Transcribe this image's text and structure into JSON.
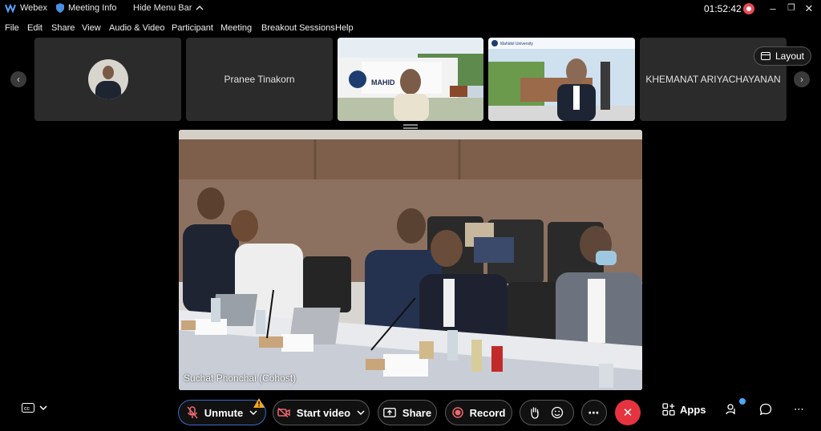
{
  "titlebar": {
    "app_name": "Webex",
    "meeting_info": "Meeting Info",
    "hide_menu_bar": "Hide Menu Bar",
    "time": "01:52:42"
  },
  "menu": [
    "File",
    "Edit",
    "Share",
    "View",
    "Audio & Video",
    "Participant",
    "Meeting",
    "Breakout Sessions",
    "Help"
  ],
  "participants": {
    "tile2_name": "Pranee Tinakorn",
    "tile5_name": "KHEMANAT ARIYACHAYANAN",
    "tile3_sign": "MAHID",
    "tile4_sign": "Mahidol University"
  },
  "layout_label": "Layout",
  "main_video": {
    "speaker": "Suchat Phonchai (Cohost)"
  },
  "controls": {
    "unmute": "Unmute",
    "start_video": "Start video",
    "share": "Share",
    "record": "Record",
    "apps": "Apps"
  },
  "colors": {
    "end_call": "#e5343f",
    "record_dot": "#e84955",
    "notification": "#4aa8ff"
  }
}
